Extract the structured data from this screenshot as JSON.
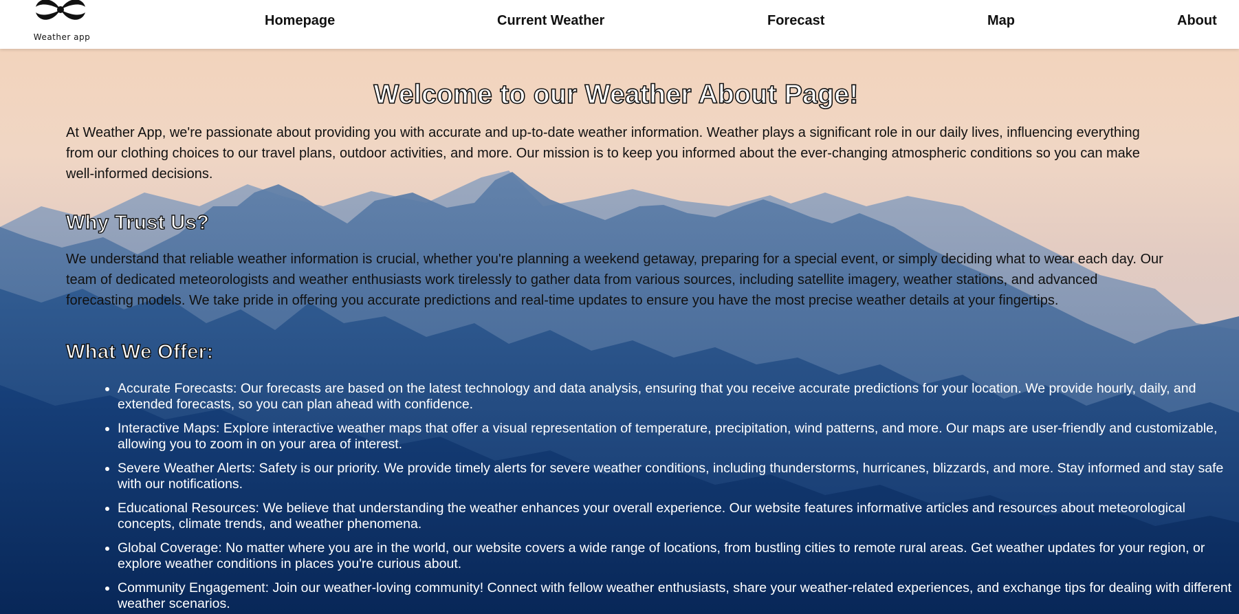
{
  "header": {
    "logo_text": "Weather app",
    "nav": [
      {
        "label": "Homepage"
      },
      {
        "label": "Current Weather"
      },
      {
        "label": "Forecast"
      },
      {
        "label": "Map"
      },
      {
        "label": "About"
      }
    ]
  },
  "main": {
    "title": "Welcome to our Weather About Page!",
    "intro": "At Weather App, we're passionate about providing you with accurate and up-to-date weather information. Weather plays a significant role in our daily lives, influencing everything from our clothing choices to our travel plans, outdoor activities, and more. Our mission is to keep you informed about the ever-changing atmospheric conditions so you can make well-informed decisions.",
    "trust_heading": "Why Trust Us?",
    "trust_text": "We understand that reliable weather information is crucial, whether you're planning a weekend getaway, preparing for a special event, or simply deciding what to wear each day. Our team of dedicated meteorologists and weather enthusiasts work tirelessly to gather data from various sources, including satellite imagery, weather stations, and advanced forecasting models. We take pride in offering you accurate predictions and real-time updates to ensure you have the most precise weather details at your fingertips.",
    "offer_heading": "What We Offer:",
    "offers": [
      "Accurate Forecasts: Our forecasts are based on the latest technology and data analysis, ensuring that you receive accurate predictions for your location. We provide hourly, daily, and extended forecasts, so you can plan ahead with confidence.",
      "Interactive Maps: Explore interactive weather maps that offer a visual representation of temperature, precipitation, wind patterns, and more. Our maps are user-friendly and customizable, allowing you to zoom in on your area of interest.",
      "Severe Weather Alerts: Safety is our priority. We provide timely alerts for severe weather conditions, including thunderstorms, hurricanes, blizzards, and more. Stay informed and stay safe with our notifications.",
      "Educational Resources: We believe that understanding the weather enhances your overall experience. Our website features informative articles and resources about meteorological concepts, climate trends, and weather phenomena.",
      "Global Coverage: No matter where you are in the world, our website covers a wide range of locations, from bustling cities to remote rural areas. Get weather updates for your region, or explore weather conditions in places you're curious about.",
      "Community Engagement: Join our weather-loving community! Connect with fellow weather enthusiasts, share your weather-related experiences, and exchange tips for dealing with different weather scenarios."
    ]
  },
  "colors": {
    "sky_top": "#f6d9c2",
    "sky_mid": "#e8c6b4",
    "mountain_far": "#7d93b3",
    "mountain_mid": "#4d6f9c",
    "mountain_near": "#1f4a82",
    "mountain_base": "#0b3068"
  },
  "icons": {
    "logo": "swirl-logo-icon",
    "bullet": "disc-bullet-icon"
  }
}
